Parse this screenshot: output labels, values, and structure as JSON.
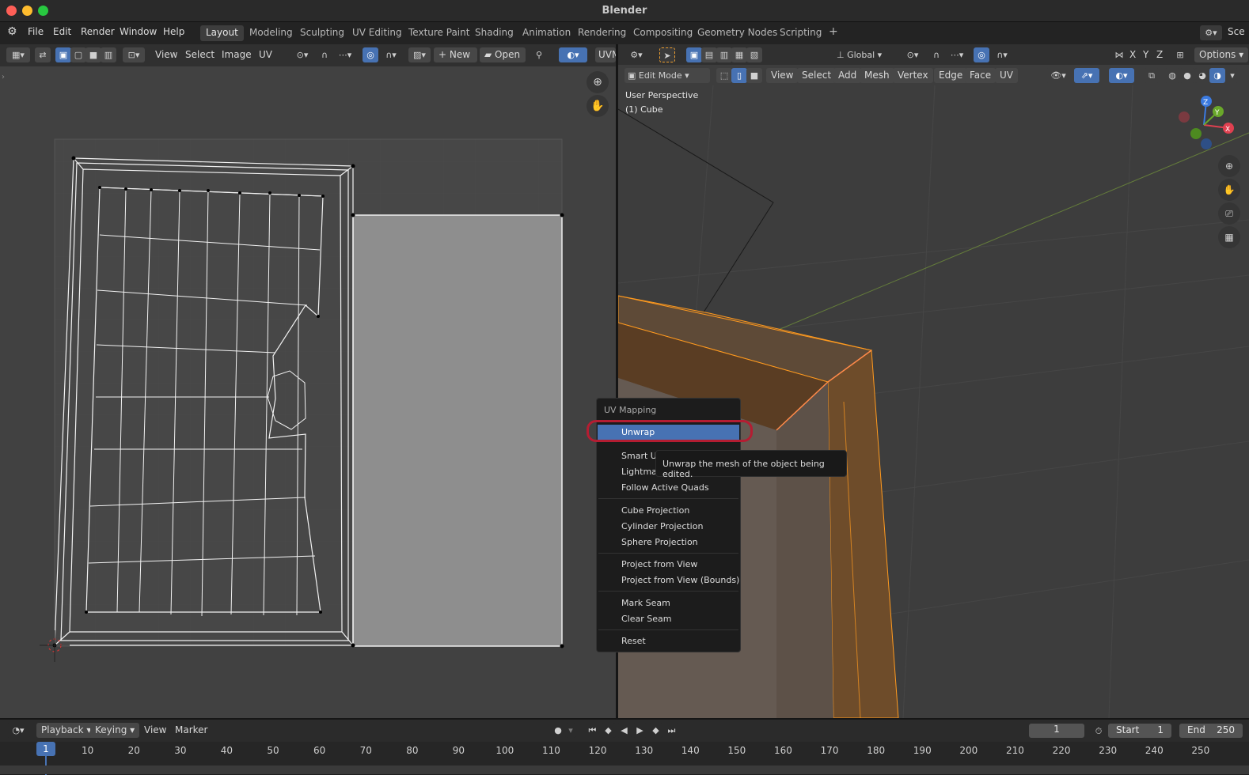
{
  "app_title": "Blender",
  "menu": [
    "File",
    "Edit",
    "Render",
    "Window",
    "Help"
  ],
  "workspaces": [
    "Layout",
    "Modeling",
    "Sculpting",
    "UV Editing",
    "Texture Paint",
    "Shading",
    "Animation",
    "Rendering",
    "Compositing",
    "Geometry Nodes",
    "Scripting"
  ],
  "active_workspace": "Layout",
  "scene_label": "Sce",
  "uv_header": {
    "view": "View",
    "select": "Select",
    "image": "Image",
    "uv": "UV",
    "new": "New",
    "open": "Open",
    "uvmap": "UVM"
  },
  "vp_top": {
    "orientation": "Global",
    "options": "Options",
    "axes": [
      "X",
      "Y",
      "Z"
    ]
  },
  "vp_header": {
    "mode": "Edit Mode",
    "view": "View",
    "select": "Select",
    "add": "Add",
    "mesh": "Mesh",
    "vertex": "Vertex",
    "edge": "Edge",
    "face": "Face",
    "uv": "UV"
  },
  "viewport": {
    "perspective": "User Perspective",
    "object": "(1) Cube"
  },
  "gizmo": {
    "z": "Z",
    "y": "Y",
    "x": "X"
  },
  "context_menu": {
    "title": "UV Mapping",
    "unwrap": "Unwrap",
    "smart": "Smart U",
    "lightmap": "Lightma",
    "follow": "Follow Active Quads",
    "cube": "Cube Projection",
    "cylinder": "Cylinder Projection",
    "sphere": "Sphere Projection",
    "proj_view": "Project from View",
    "proj_bounds": "Project from View (Bounds)",
    "mark_seam": "Mark Seam",
    "clear_seam": "Clear Seam",
    "reset": "Reset"
  },
  "tooltip": "Unwrap the mesh of the object being edited.",
  "timeline": {
    "playback": "Playback",
    "keying": "Keying",
    "view": "View",
    "marker": "Marker",
    "current_frame": "1",
    "start_label": "Start",
    "start": "1",
    "end_label": "End",
    "end": "250",
    "ticks": [
      "1",
      "10",
      "20",
      "30",
      "40",
      "50",
      "60",
      "70",
      "80",
      "90",
      "100",
      "110",
      "120",
      "130",
      "140",
      "150",
      "160",
      "170",
      "180",
      "190",
      "200",
      "210",
      "220",
      "230",
      "240",
      "250"
    ]
  },
  "colors": {
    "accent": "#4772b3",
    "selection": "#ff9a1f",
    "highlight_ring": "#b41d32"
  }
}
